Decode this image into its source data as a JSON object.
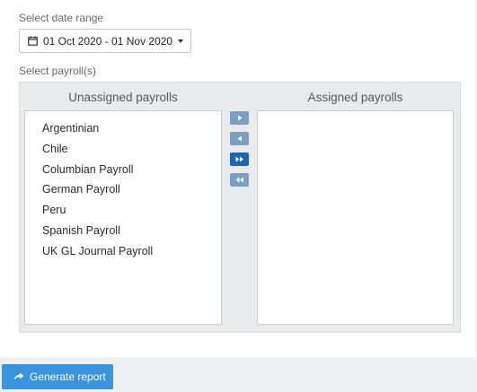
{
  "date_range": {
    "label": "Select date range",
    "value": "01 Oct 2020 - 01 Nov 2020"
  },
  "payrolls": {
    "label": "Select payroll(s)",
    "unassigned_title": "Unassigned payrolls",
    "assigned_title": "Assigned payrolls",
    "unassigned": [
      "Argentinian",
      "Chile",
      "Columbian Payroll",
      "German Payroll",
      "Peru",
      "Spanish Payroll",
      "UK GL Journal Payroll"
    ],
    "assigned": []
  },
  "actions": {
    "generate_label": "Generate report"
  },
  "colors": {
    "accent": "#3a93dd",
    "move_button": "#7b9fc4",
    "move_button_active": "#1d64b5"
  },
  "icons": {
    "date": "calendar-icon",
    "move_one_right": "triangle-right-icon",
    "move_one_left": "triangle-left-icon",
    "move_all_right": "double-triangle-right-icon",
    "move_all_left": "double-triangle-left-icon",
    "generate": "share-arrow-icon"
  }
}
